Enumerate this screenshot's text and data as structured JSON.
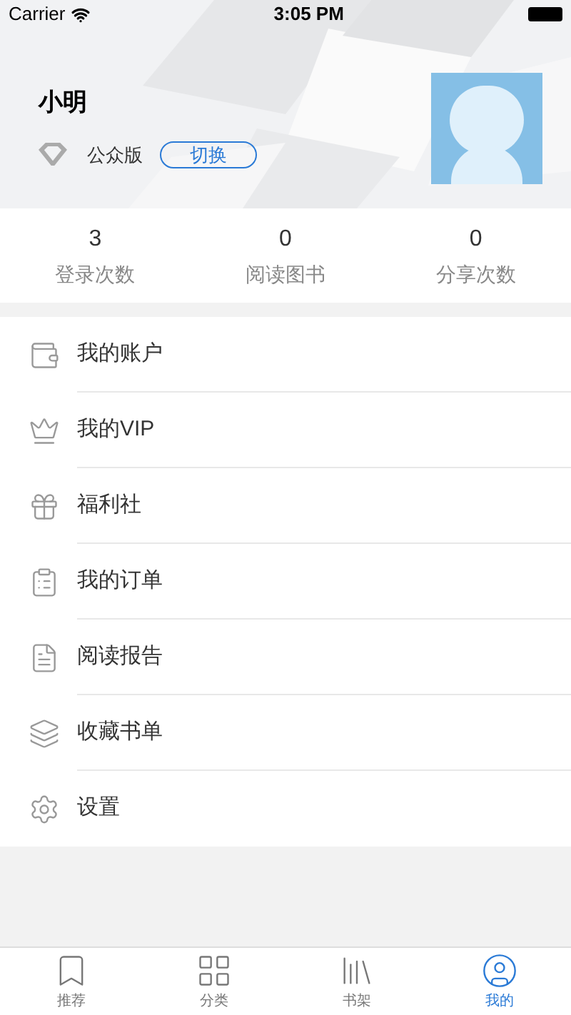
{
  "status_bar": {
    "carrier": "Carrier",
    "time": "3:05 PM"
  },
  "profile": {
    "name": "小明",
    "edition": "公众版",
    "switch_button": "切换"
  },
  "stats": [
    {
      "value": "3",
      "label": "登录次数"
    },
    {
      "value": "0",
      "label": "阅读图书"
    },
    {
      "value": "0",
      "label": "分享次数"
    }
  ],
  "menu": [
    {
      "label": "我的账户"
    },
    {
      "label": "我的VIP"
    },
    {
      "label": "福利社"
    },
    {
      "label": "我的订单"
    },
    {
      "label": "阅读报告"
    },
    {
      "label": "收藏书单"
    },
    {
      "label": "设置"
    }
  ],
  "tab_bar": [
    {
      "label": "推荐",
      "selected": false
    },
    {
      "label": "分类",
      "selected": false
    },
    {
      "label": "书架",
      "selected": false
    },
    {
      "label": "我的",
      "selected": true
    }
  ]
}
